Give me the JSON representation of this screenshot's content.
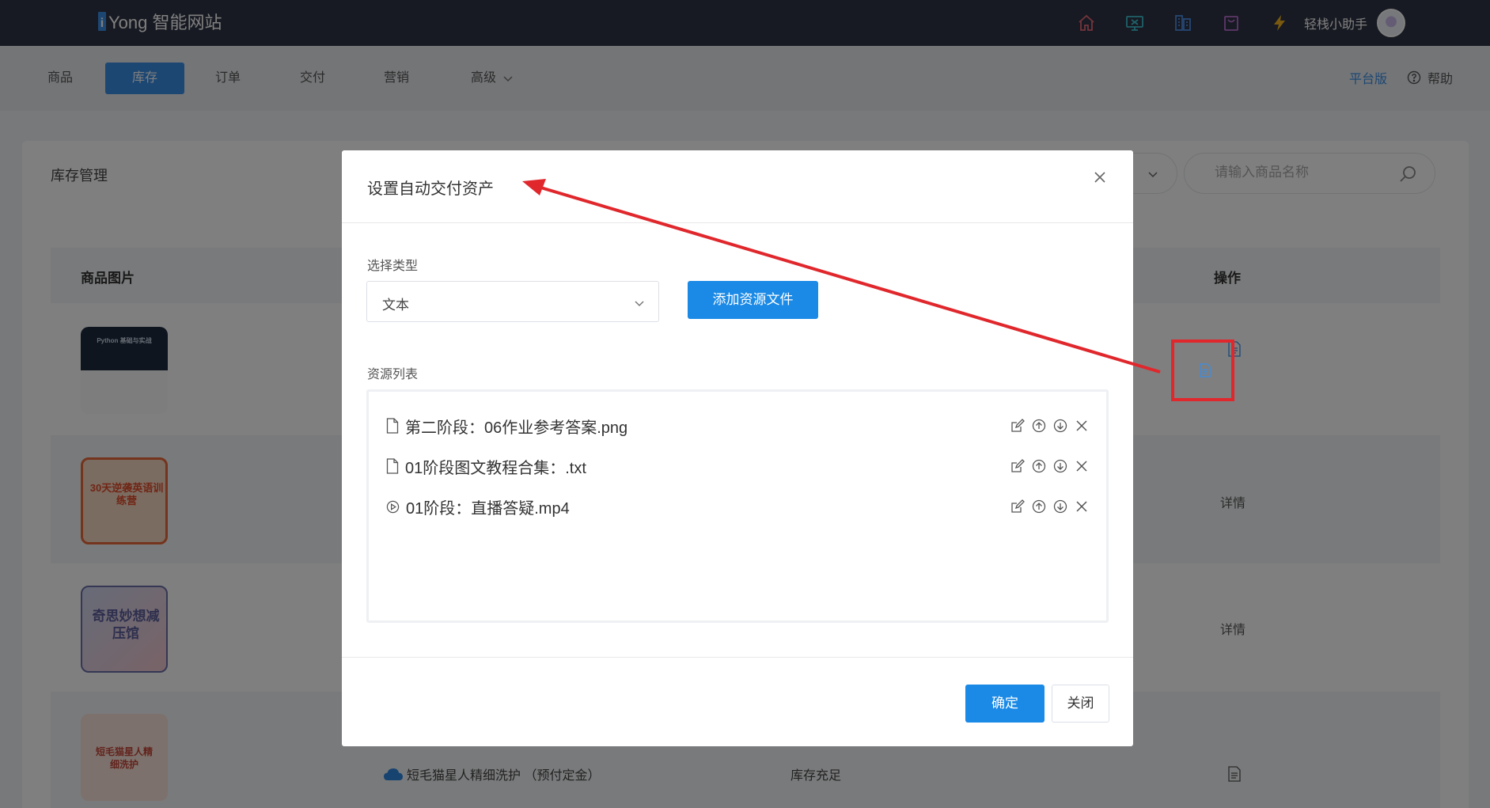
{
  "header": {
    "logo_mark": "i",
    "logo_text": "Yong 智能网站",
    "icons": [
      "home-icon",
      "monitor-icon",
      "building-icon",
      "bag-icon",
      "lightning-icon"
    ],
    "user_name": "轻栈小助手"
  },
  "nav": {
    "items": [
      {
        "label": "商品",
        "active": false
      },
      {
        "label": "库存",
        "active": true
      },
      {
        "label": "订单",
        "active": false
      },
      {
        "label": "交付",
        "active": false
      },
      {
        "label": "营销",
        "active": false
      },
      {
        "label": "高级",
        "active": false
      }
    ],
    "platform_label": "平台版",
    "help_label": "帮助"
  },
  "page": {
    "title": "库存管理",
    "search_placeholder": "请输入商品名称",
    "columns": {
      "image": "商品图片",
      "action": "操作"
    },
    "rows": [
      {
        "thumb_title": "Python 基础与实战",
        "action": ""
      },
      {
        "thumb_title": "30天逆袭英语训练营",
        "action": "详情"
      },
      {
        "thumb_title": "奇思妙想减压馆",
        "action": "详情"
      },
      {
        "thumb_title": "短毛猫星人精细洗护",
        "name": "短毛猫星人精细洗护 （预付定金）",
        "stock": "库存充足",
        "action": ""
      }
    ]
  },
  "dialog": {
    "title": "设置自动交付资产",
    "type_label": "选择类型",
    "type_value": "文本",
    "add_button": "添加资源文件",
    "list_label": "资源列表",
    "resources": [
      {
        "name": "第二阶段：06作业参考答案.png",
        "kind": "file-icon"
      },
      {
        "name": "01阶段图文教程合集：.txt",
        "kind": "file-icon"
      },
      {
        "name": "01阶段：直播答疑.mp4",
        "kind": "play-icon"
      }
    ],
    "ok_button": "确定",
    "close_button": "关闭"
  },
  "colors": {
    "topbar": "#2f3445",
    "primary": "#1a8ae6",
    "annotation": "#e0272c"
  }
}
